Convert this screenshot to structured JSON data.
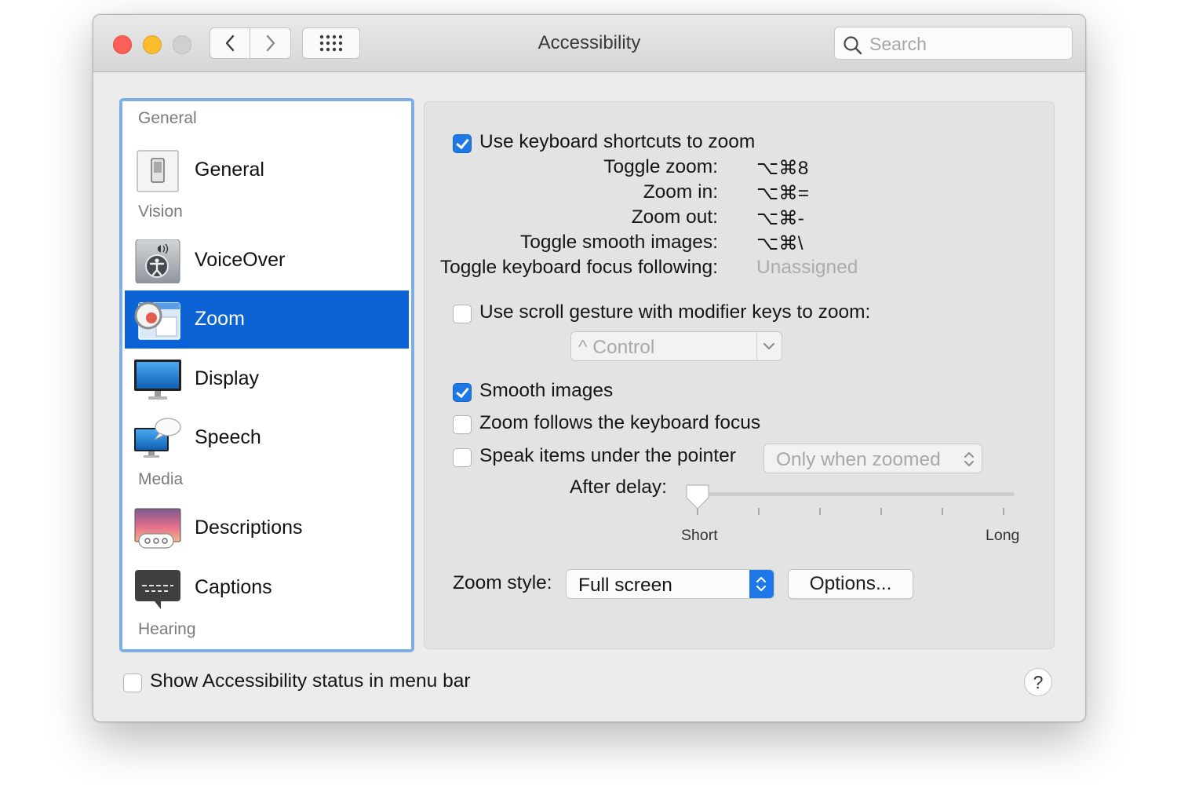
{
  "window": {
    "title": "Accessibility",
    "search": {
      "placeholder": "Search",
      "value": ""
    },
    "icons": {
      "back": "chevron-left-icon",
      "forward": "chevron-right-icon",
      "grid": "grid-icon",
      "search": "magnifier-icon"
    }
  },
  "sidebar": {
    "sections": [
      {
        "label": "General"
      },
      {
        "label": "Vision"
      },
      {
        "label": "Media"
      },
      {
        "label": "Hearing"
      }
    ],
    "items": [
      {
        "label": "General",
        "icon": "switch-icon",
        "selected": false
      },
      {
        "label": "VoiceOver",
        "icon": "voiceover-icon",
        "selected": false
      },
      {
        "label": "Zoom",
        "icon": "zoom-icon",
        "selected": true
      },
      {
        "label": "Display",
        "icon": "display-icon",
        "selected": false
      },
      {
        "label": "Speech",
        "icon": "speech-icon",
        "selected": false
      },
      {
        "label": "Descriptions",
        "icon": "descriptions-icon",
        "selected": false
      },
      {
        "label": "Captions",
        "icon": "captions-icon",
        "selected": false
      }
    ]
  },
  "zoom": {
    "keyboard_shortcuts": {
      "label": "Use keyboard shortcuts to zoom",
      "checked": true,
      "shortcuts": [
        {
          "name": "Toggle zoom:",
          "keys": "⌥⌘8"
        },
        {
          "name": "Zoom in:",
          "keys": "⌥⌘="
        },
        {
          "name": "Zoom out:",
          "keys": "⌥⌘-"
        },
        {
          "name": "Toggle smooth images:",
          "keys": "⌥⌘\\"
        },
        {
          "name": "Toggle keyboard focus following:",
          "keys": "Unassigned"
        }
      ]
    },
    "scroll_gesture": {
      "label": "Use scroll gesture with modifier keys to zoom:",
      "checked": false,
      "modifier": "^ Control"
    },
    "smooth_images": {
      "label": "Smooth images",
      "checked": true
    },
    "follow_focus": {
      "label": "Zoom follows the keyboard focus",
      "checked": false
    },
    "speak_items": {
      "label": "Speak items under the pointer",
      "checked": false,
      "mode": "Only when zoomed"
    },
    "delay": {
      "label": "After delay:",
      "min_label": "Short",
      "max_label": "Long",
      "value": 0
    },
    "zoom_style": {
      "label": "Zoom style:",
      "value": "Full screen",
      "options_button": "Options..."
    }
  },
  "footer": {
    "status_menu": {
      "label": "Show Accessibility status in menu bar",
      "checked": false
    },
    "help": "?"
  },
  "colors": {
    "selection": "#0b63d6",
    "checkbox_checked": "#1f78e7",
    "sidebar_border": "#7eaee6"
  }
}
